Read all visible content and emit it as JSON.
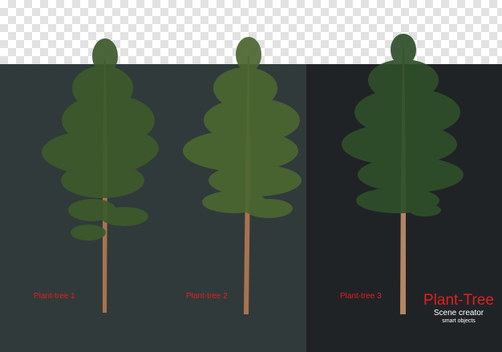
{
  "background": {
    "checker_light": "#ffffff",
    "checker_dark": "#e2e2e2"
  },
  "panels": [
    {
      "name": "panel-grey",
      "color": "#303a3b"
    },
    {
      "name": "panel-dark",
      "color": "#202326"
    }
  ],
  "trees": [
    {
      "label": "Plant-tree 1",
      "foliage": "#3c5a2a",
      "trunk": "#a8734f"
    },
    {
      "label": "Plant-tree 2",
      "foliage": "#4b6630",
      "trunk": "#a8734f"
    },
    {
      "label": "Plant-tree 3",
      "foliage": "#2f4f2a",
      "trunk": "#b58563"
    }
  ],
  "brand": {
    "title": "Plant-Tree",
    "subtitle": "Scene creator",
    "tagline": "smart objects",
    "accent": "#e02020"
  }
}
